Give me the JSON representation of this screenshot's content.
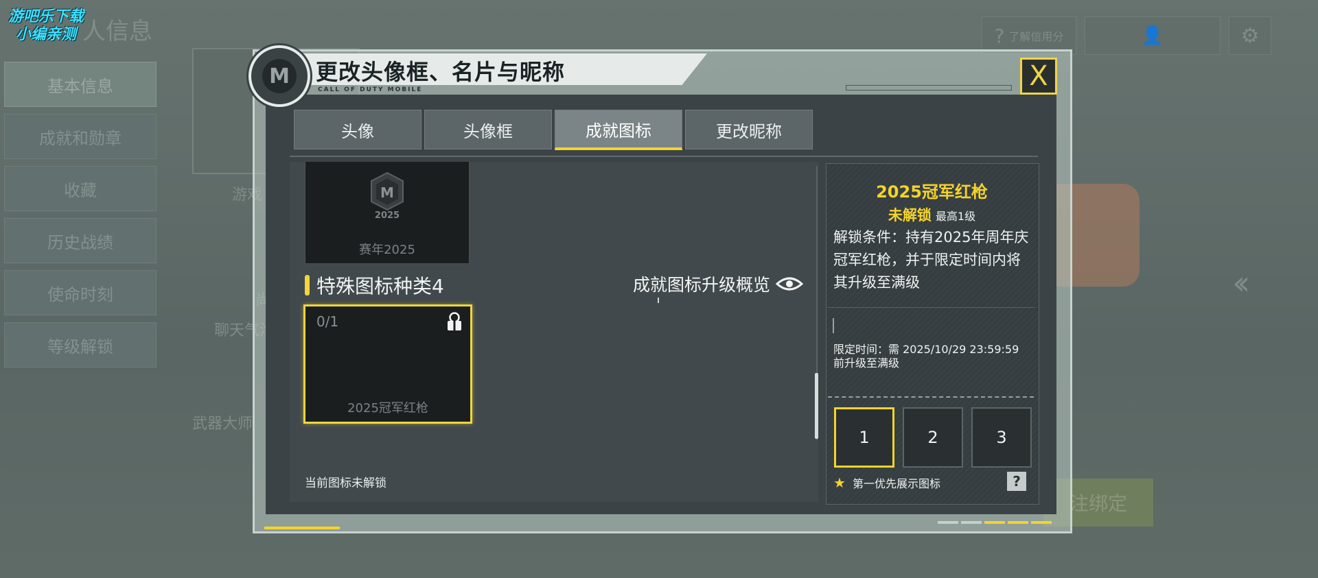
{
  "watermark": {
    "line1": "游吧乐下载",
    "line2": "小编亲测"
  },
  "background": {
    "title": "人信息",
    "side_menu": [
      "基本信息",
      "成就和勋章",
      "收藏",
      "历史战绩",
      "使命时刻",
      "等级解锁"
    ],
    "labels": {
      "game": "游戏",
      "chat_bubble": "聊天气泡",
      "weapon_master": "武器大师",
      "fragment": "尚"
    },
    "credit_button": "了解信用分",
    "bind_button": "注绑定"
  },
  "dialog": {
    "title": "更改头像框、名片与昵称",
    "subtitle": "CALL OF DUTY MOBILE",
    "close_icon": "X",
    "logo_icon": "cod-m-logo",
    "tabs": [
      "头像",
      "头像框",
      "成就图标",
      "更改昵称"
    ],
    "active_tab": 2
  },
  "grid": {
    "season_card": {
      "label": "赛年2025",
      "emblem_text": "2025",
      "emblem_letter": "M"
    },
    "category_heading": "特殊图标种类4",
    "overview_link": "成就图标升级概览",
    "selected_card": {
      "count": "0/1",
      "label": "2025冠军红枪",
      "icon": "gift-lock-icon"
    },
    "status_text": "当前图标未解锁"
  },
  "detail": {
    "title": "2025冠军红枪",
    "status": "未解锁",
    "level": "最高1级",
    "condition": "解锁条件：持有2025年周年庆冠军红枪，并于限定时间内将其升级至满级",
    "time_line1": "限定时间：需 2025/10/29 23:59:59",
    "time_line2": "前升级至满级",
    "slots": [
      "1",
      "2",
      "3"
    ],
    "active_slot": 0,
    "priority_label": "第一优先展示图标",
    "help_label": "?"
  },
  "colors": {
    "accent": "#f5d42a",
    "panel": "#3c4346",
    "card": "#1b1e1f"
  }
}
